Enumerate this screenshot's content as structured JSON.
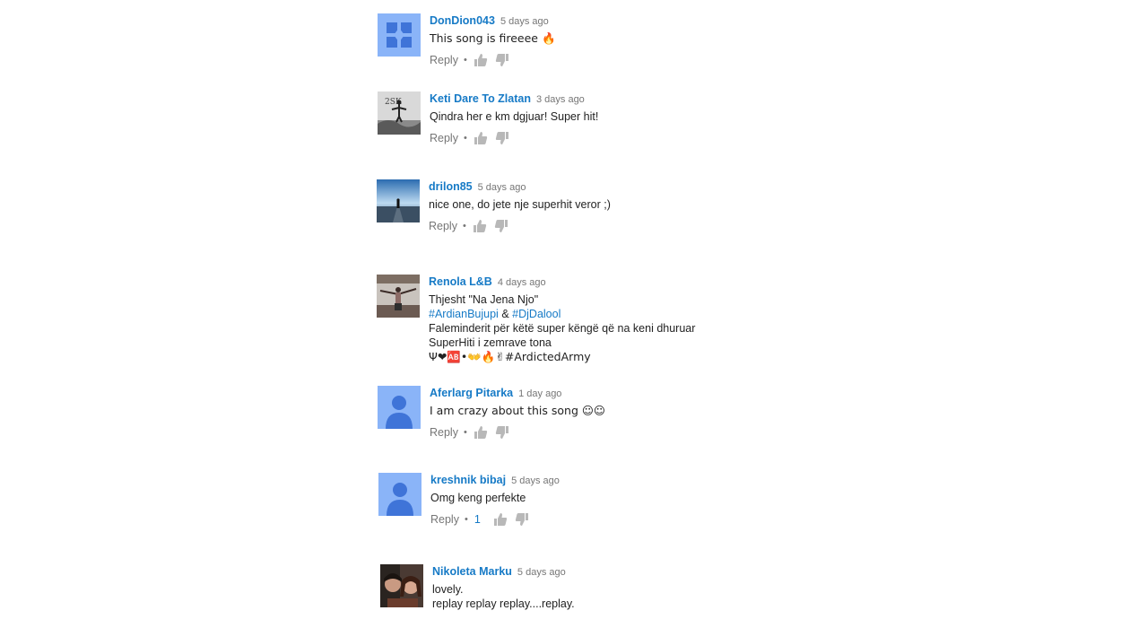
{
  "reply_label": "Reply",
  "bullet": "•",
  "colors": {
    "author": "#167ac6",
    "text": "#222222",
    "meta": "#767676",
    "default_avatar_bg": "#8ab4f8",
    "default_avatar_fg": "#3f74d8"
  },
  "comments": [
    {
      "author": "DonDion043",
      "time": "5 days ago",
      "avatar_icon": "blue-square-avatar-icon",
      "lines": [
        "This song is fireeee 🔥"
      ]
    },
    {
      "author": "Keti Dare To Zlatan",
      "time": "3 days ago",
      "avatar_icon": "photo-avatar-icon",
      "lines": [
        "Qindra her e km dgjuar! Super hit!"
      ]
    },
    {
      "author": "drilon85",
      "time": "5 days ago",
      "avatar_icon": "photo-avatar-icon",
      "lines": [
        "nice one, do jete nje superhit veror ;)"
      ]
    },
    {
      "author": "Renola L&B",
      "time": "4 days ago",
      "avatar_icon": "photo-avatar-icon",
      "line1": "Thjesht \"Na Jena Njo\"",
      "hashtag1": "#ArdianBujupi",
      "amp": "&",
      "hashtag2": "#DjDalool",
      "line3": "Faleminderit për këtë super këngë që na keni dhuruar",
      "line4": "SuperHiti i zemrave tona",
      "line5": "Ψ❤🆎•👐🔥✌#ArdictedArmy"
    },
    {
      "author": "Aferlarg Pitarka",
      "time": "1 day ago",
      "avatar_icon": "default-user-avatar-icon",
      "lines": [
        "I am crazy about this song ☺☺"
      ]
    },
    {
      "author": "kreshnik bibaj",
      "time": "5 days ago",
      "avatar_icon": "default-user-avatar-icon",
      "like_count": "1",
      "lines": [
        "Omg keng perfekte"
      ]
    },
    {
      "author": "Nikoleta Marku",
      "time": "5 days ago",
      "avatar_icon": "photo-avatar-icon",
      "lines": [
        "lovely.",
        "replay replay replay....replay."
      ]
    }
  ]
}
